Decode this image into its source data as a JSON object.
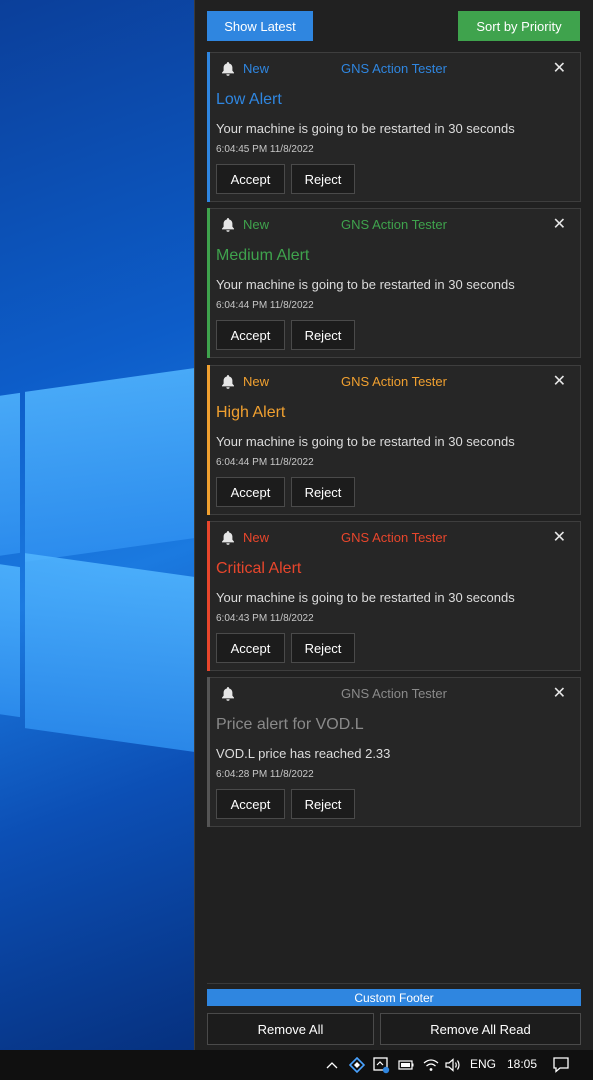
{
  "toolbar": {
    "show_latest": "Show Latest",
    "sort_priority": "Sort by Priority"
  },
  "colors": {
    "low": "#2f86e0",
    "medium": "#3fa34d",
    "high": "#f0a030",
    "critical": "#e8462c",
    "none": "#8a8a8a"
  },
  "notifications": [
    {
      "status": "New",
      "source": "GNS Action Tester",
      "title": "Low Alert",
      "message": "Your machine is going to be restarted in 30 seconds",
      "time": "6:04:45 PM 11/8/2022",
      "accept": "Accept",
      "reject": "Reject"
    },
    {
      "status": "New",
      "source": "GNS Action Tester",
      "title": "Medium Alert",
      "message": "Your machine is going to be restarted in 30 seconds",
      "time": "6:04:44 PM 11/8/2022",
      "accept": "Accept",
      "reject": "Reject"
    },
    {
      "status": "New",
      "source": "GNS Action Tester",
      "title": "High Alert",
      "message": "Your machine is going to be restarted in 30 seconds",
      "time": "6:04:44 PM 11/8/2022",
      "accept": "Accept",
      "reject": "Reject"
    },
    {
      "status": "New",
      "source": "GNS Action Tester",
      "title": "Critical Alert",
      "message": "Your machine is going to be restarted in 30 seconds",
      "time": "6:04:43 PM 11/8/2022",
      "accept": "Accept",
      "reject": "Reject"
    },
    {
      "status": "",
      "source": "GNS Action Tester",
      "title": "Price alert for VOD.L",
      "message": "VOD.L price has reached 2.33",
      "time": "6:04:28 PM 11/8/2022",
      "accept": "Accept",
      "reject": "Reject"
    }
  ],
  "footer": {
    "custom": "Custom Footer",
    "remove_all": "Remove All",
    "remove_all_read": "Remove All Read"
  },
  "taskbar": {
    "language": "ENG",
    "clock": "18:05"
  }
}
